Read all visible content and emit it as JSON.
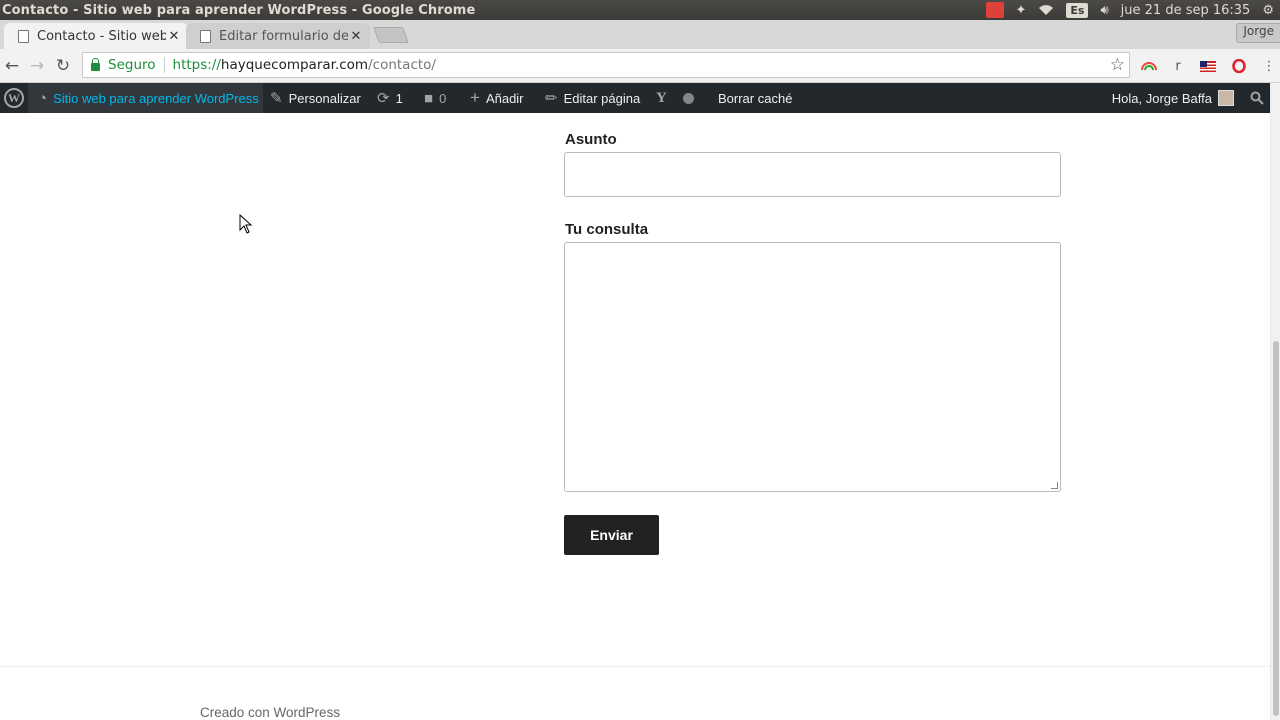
{
  "os": {
    "window_title": "Contacto - Sitio web para aprender WordPress - Google Chrome",
    "lang": "Es",
    "clock": "jue 21 de sep 16:35"
  },
  "chrome": {
    "tabs": [
      {
        "label": "Contacto - Sitio web para aprender WordPress",
        "active": true
      },
      {
        "label": "Editar formulario de contacto",
        "active": false
      }
    ],
    "profile_name": "Jorge",
    "omnibox": {
      "security_label": "Seguro",
      "url_scheme": "https://",
      "url_host": "hayquecomparar.com",
      "url_path": "/contacto/"
    },
    "extension_r": "r"
  },
  "adminbar": {
    "site_name": "Sitio web para aprender WordPress",
    "customize": "Personalizar",
    "updates_count": "1",
    "comments_count": "0",
    "add_new": "Añadir",
    "edit_page": "Editar página",
    "clear_cache": "Borrar caché",
    "greeting": "Hola, Jorge Baffa"
  },
  "form": {
    "subject_label": "Asunto",
    "subject_value": "",
    "message_label": "Tu consulta",
    "message_value": "",
    "submit_label": "Enviar"
  },
  "footer": {
    "credit": "Creado con WordPress"
  }
}
